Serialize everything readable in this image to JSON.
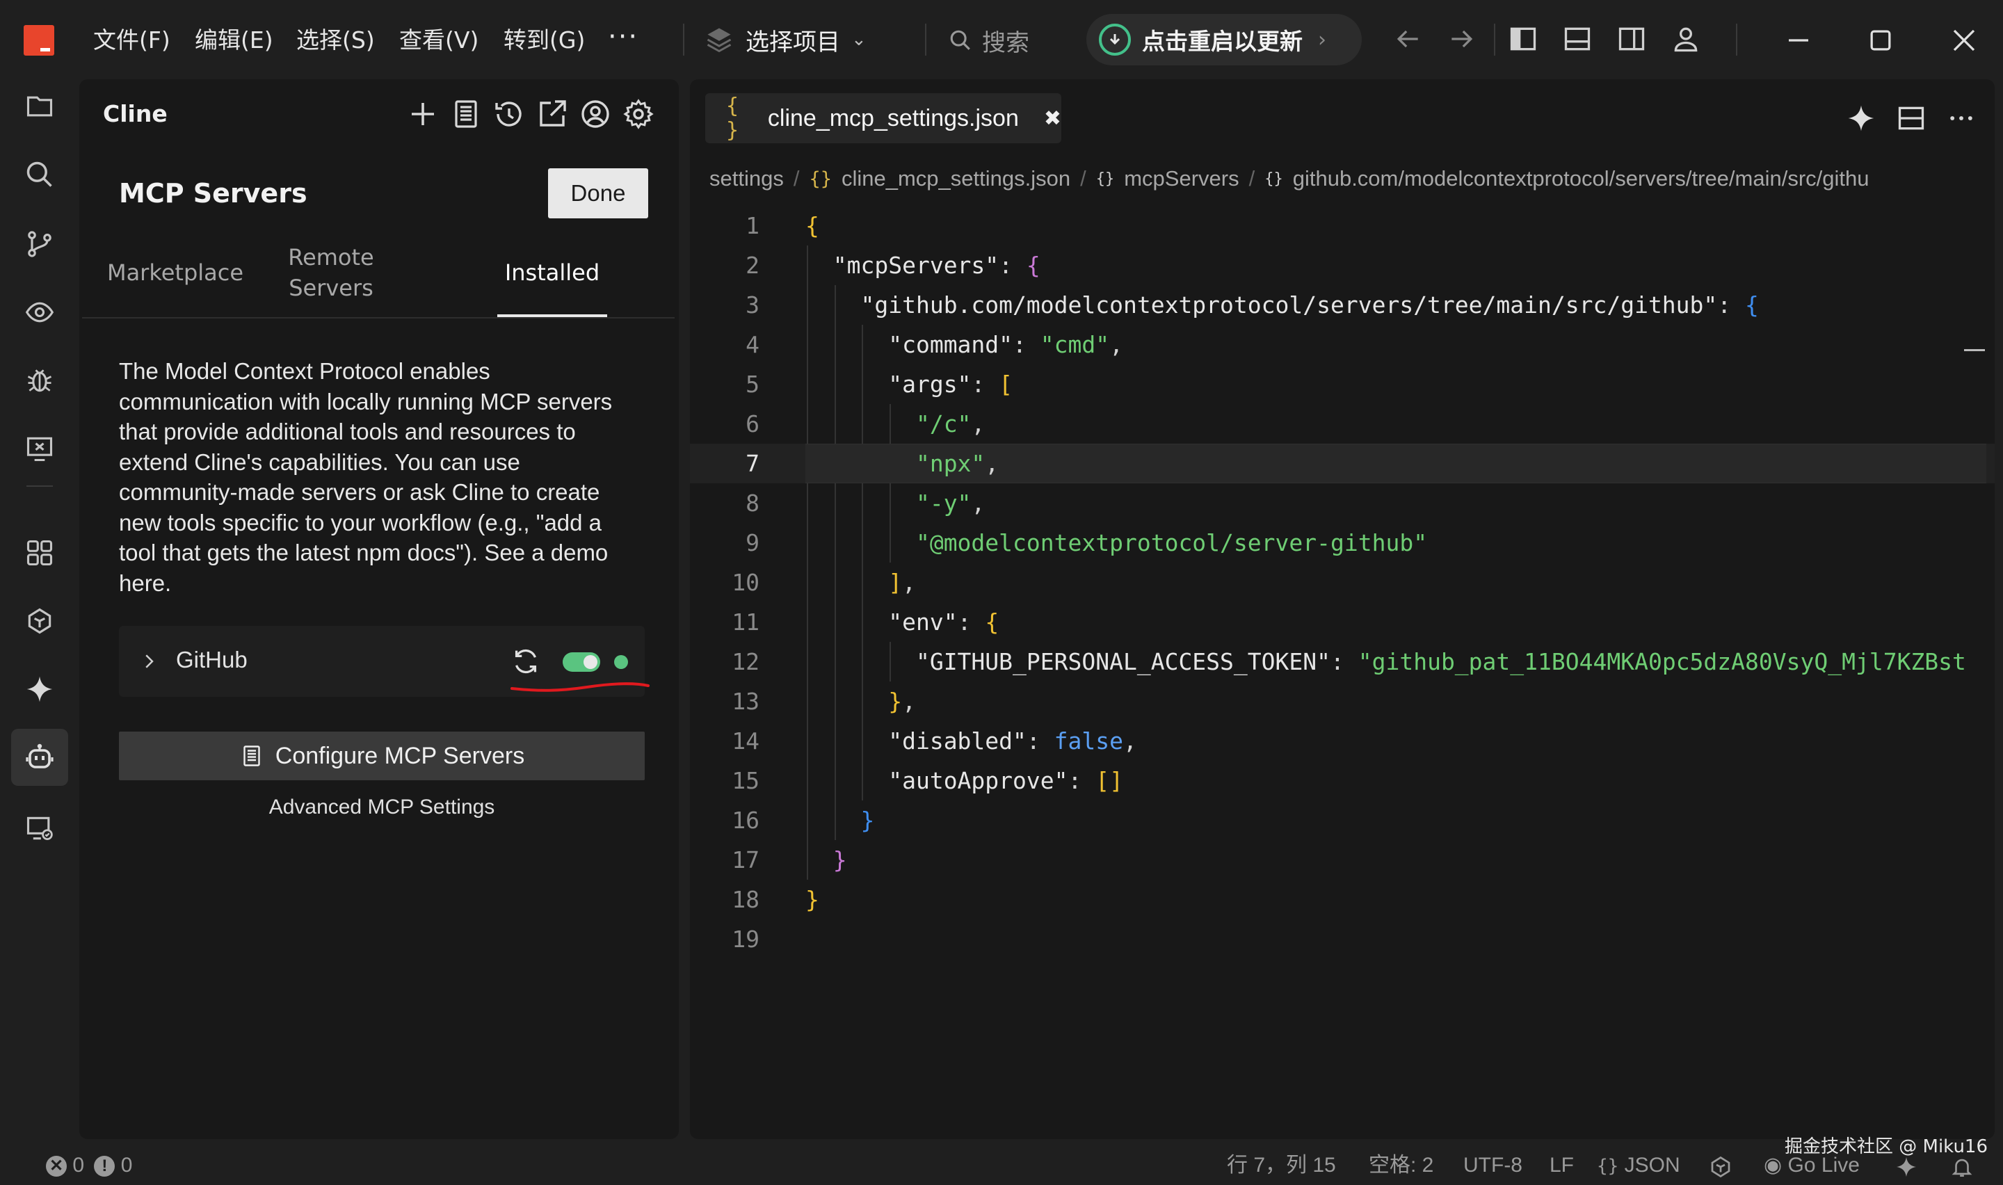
{
  "window": {
    "menu": [
      "文件(F)",
      "编辑(E)",
      "选择(S)",
      "查看(V)",
      "转到(G)"
    ],
    "more": "···",
    "project_label": "选择项目",
    "search_placeholder": "搜索",
    "update_label": "点击重启以更新"
  },
  "cline": {
    "title": "Cline",
    "mcp_title": "MCP Servers",
    "done_label": "Done",
    "tabs": [
      "Marketplace",
      "Remote Servers",
      "Installed"
    ],
    "active_tab": "Installed",
    "description": "The Model Context Protocol enables communication with locally running MCP servers that provide additional tools and resources to extend Cline's capabilities. You can use community-made servers or ask Cline to create new tools specific to your workflow (e.g., \"add a tool that gets the latest npm docs\"). See a demo here.",
    "server": {
      "name": "GitHub",
      "enabled": true,
      "status_color": "#5ac480"
    },
    "configure_label": "Configure MCP Servers",
    "advanced_label": "Advanced MCP Settings"
  },
  "editor": {
    "tab_icon": "{ }",
    "tab_name": "cline_mcp_settings.json",
    "tab_close": "✖",
    "breadcrumbs": [
      "settings",
      "cline_mcp_settings.json",
      "mcpServers",
      "github.com/modelcontextprotocol/servers/tree/main/src/githu"
    ],
    "current_line": 7,
    "lines": [
      "{",
      "  \"mcpServers\": {",
      "    \"github.com/modelcontextprotocol/servers/tree/main/src/github\": {",
      "      \"command\": \"cmd\",",
      "      \"args\": [",
      "        \"/c\",",
      "        \"npx\",",
      "        \"-y\",",
      "        \"@modelcontextprotocol/server-github\"",
      "      ],",
      "      \"env\": {",
      "        \"GITHUB_PERSONAL_ACCESS_TOKEN\": \"github_pat_11BO44MKA0pc5dzA80VsyQ_Mjl7KZBst",
      "      },",
      "      \"disabled\": false,",
      "      \"autoApprove\": []",
      "    }",
      "  }",
      "}",
      ""
    ]
  },
  "statusbar": {
    "errors": "0",
    "warnings": "0",
    "position": "行 7，列 15",
    "indent": "空格: 2",
    "encoding": "UTF-8",
    "eol": "LF",
    "language": "JSON",
    "go_live": "Go Live",
    "watermark": "掘金技术社区 @ Miku16"
  },
  "colors": {
    "accent_green": "#5ac480",
    "string": "#6fce74",
    "bracket_yellow": "#f1c232",
    "bracket_purple": "#c979d6",
    "bracket_blue": "#3f8ef0",
    "annotation_red": "#e0191e"
  }
}
